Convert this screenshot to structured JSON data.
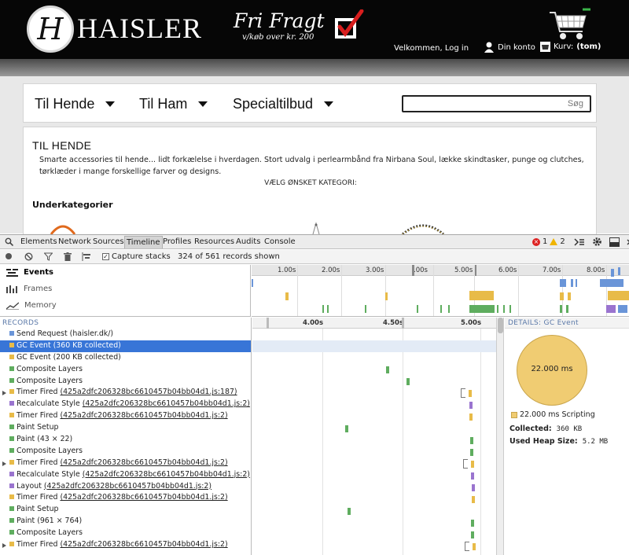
{
  "site": {
    "logo_letter": "H",
    "brand": "HAISLER",
    "promo_title": "Fri Fragt",
    "promo_sub": "v/køb over kr. 200",
    "welcome": "Velkommen, Log in",
    "account": "Din konto",
    "basket_label": "Kurv:",
    "basket_value": "(tom)",
    "colors": {
      "header_bg": "#060606",
      "check_red": "#d81e1e"
    }
  },
  "nav": {
    "items": [
      {
        "label": "Til Hende"
      },
      {
        "label": "Til Ham"
      },
      {
        "label": "Specialtilbud"
      }
    ],
    "search_placeholder": "Søg"
  },
  "content": {
    "title": "TIL HENDE",
    "description": "Smarte accessories til hende... lidt forkælelse i hverdagen. Stort udvalg i perlearmbånd fra Nirbana Soul, lække skindtasker, punge og clutches, tørklæder i mange forskellige farver og designs.",
    "choose": "VÆLG ØNSKET KATEGORI:",
    "subcategories_heading": "Underkategorier"
  },
  "devtools": {
    "tabs": [
      "Elements",
      "Network",
      "Sources",
      "Timeline",
      "Profiles",
      "Resources",
      "Audits",
      "Console"
    ],
    "active_tab": "Timeline",
    "errors": "1",
    "warnings": "2",
    "toolbar": {
      "capture_label": "Capture stacks",
      "records_count": "324 of 561 records shown"
    },
    "overview": {
      "rows": [
        "Events",
        "Frames",
        "Memory"
      ],
      "ticks": [
        "1.00s",
        "2.00s",
        "3.00s",
        ".00s",
        "5.00s",
        "6.00s",
        "7.00s",
        "8.00s"
      ]
    },
    "records_header": "RECORDS",
    "records": [
      {
        "name": "Send Request",
        "arg": "(haisler.dk/)",
        "link": false,
        "color": "#6a95d8",
        "expand": false
      },
      {
        "name": "GC Event",
        "arg": "(360 KB collected)",
        "link": false,
        "color": "#e8bb48",
        "expand": false,
        "selected": true
      },
      {
        "name": "GC Event",
        "arg": "(200 KB collected)",
        "link": false,
        "color": "#e8bb48",
        "expand": false
      },
      {
        "name": "Composite Layers",
        "arg": "",
        "link": false,
        "color": "#5fad5f",
        "expand": false
      },
      {
        "name": "Composite Layers",
        "arg": "",
        "link": false,
        "color": "#5fad5f",
        "expand": false
      },
      {
        "name": "Timer Fired",
        "arg": "(425a2dfc206328bc6610457b04bb04d1.js:187)",
        "link": true,
        "color": "#e8bb48",
        "expand": true
      },
      {
        "name": "Recalculate Style",
        "arg": "(425a2dfc206328bc6610457b04bb04d1.js:2)",
        "link": true,
        "color": "#9a74cf",
        "expand": false
      },
      {
        "name": "Timer Fired",
        "arg": "(425a2dfc206328bc6610457b04bb04d1.js:2)",
        "link": true,
        "color": "#e8bb48",
        "expand": false
      },
      {
        "name": "Paint Setup",
        "arg": "",
        "link": false,
        "color": "#5fad5f",
        "expand": false
      },
      {
        "name": "Paint",
        "arg": "(43 × 22)",
        "link": false,
        "color": "#5fad5f",
        "expand": false
      },
      {
        "name": "Composite Layers",
        "arg": "",
        "link": false,
        "color": "#5fad5f",
        "expand": false
      },
      {
        "name": "Timer Fired",
        "arg": "(425a2dfc206328bc6610457b04bb04d1.js:2)",
        "link": true,
        "color": "#e8bb48",
        "expand": true
      },
      {
        "name": "Recalculate Style",
        "arg": "(425a2dfc206328bc6610457b04bb04d1.js:2)",
        "link": true,
        "color": "#9a74cf",
        "expand": false
      },
      {
        "name": "Layout",
        "arg": "(425a2dfc206328bc6610457b04bb04d1.js:2)",
        "link": true,
        "color": "#9a74cf",
        "expand": false
      },
      {
        "name": "Timer Fired",
        "arg": "(425a2dfc206328bc6610457b04bb04d1.js:2)",
        "link": true,
        "color": "#e8bb48",
        "expand": false
      },
      {
        "name": "Paint Setup",
        "arg": "",
        "link": false,
        "color": "#5fad5f",
        "expand": false
      },
      {
        "name": "Paint",
        "arg": "(961 × 764)",
        "link": false,
        "color": "#5fad5f",
        "expand": false
      },
      {
        "name": "Composite Layers",
        "arg": "",
        "link": false,
        "color": "#5fad5f",
        "expand": false
      },
      {
        "name": "Timer Fired",
        "arg": "(425a2dfc206328bc6610457b04bb04d1.js:2)",
        "link": true,
        "color": "#e8bb48",
        "expand": true
      }
    ],
    "waterfall_ticks": [
      "4.00s",
      "4.50s",
      "5.00s"
    ],
    "details": {
      "header": "DETAILS: GC Event",
      "pie_label": "22.000 ms",
      "legend": "22.000 ms Scripting",
      "collected_label": "Collected:",
      "collected_value": "360 KB",
      "heap_label": "Used Heap Size:",
      "heap_value": "5.2 MB"
    }
  }
}
